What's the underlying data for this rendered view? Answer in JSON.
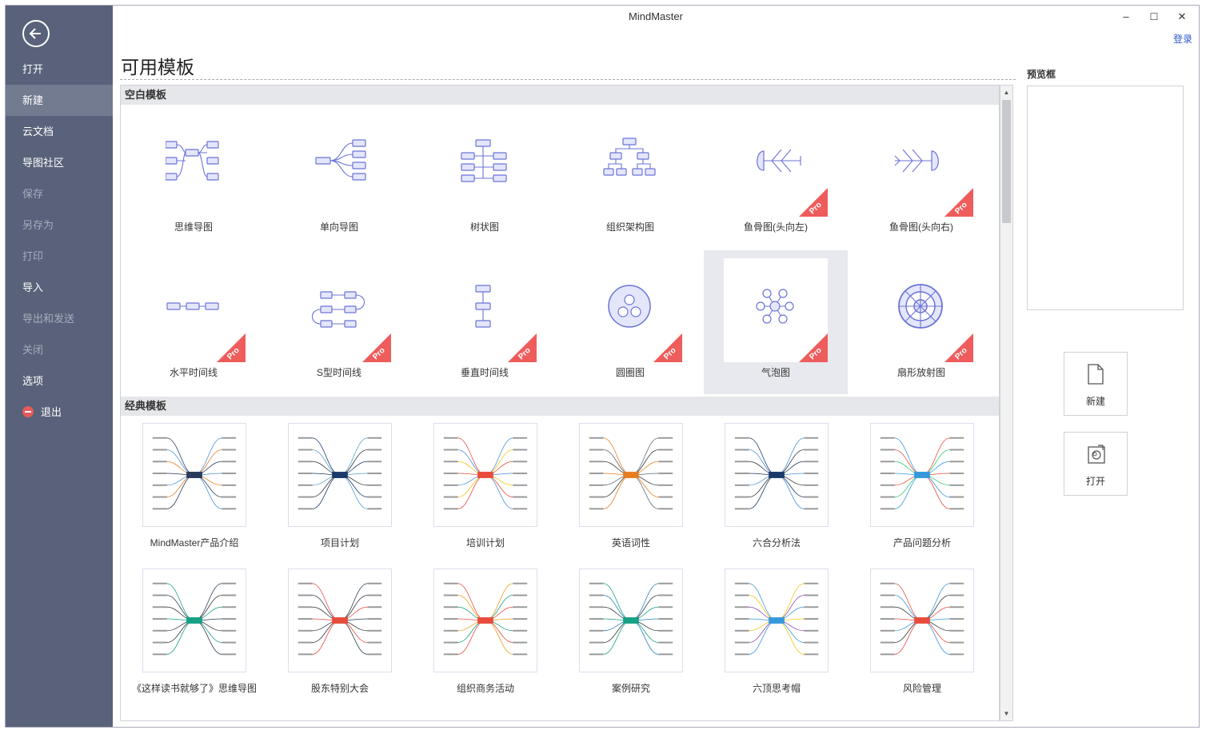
{
  "app": {
    "title": "MindMaster",
    "login": "登录",
    "page_title": "可用模板"
  },
  "sidebar": {
    "items": [
      {
        "label": "打开",
        "state": "normal"
      },
      {
        "label": "新建",
        "state": "active"
      },
      {
        "label": "云文档",
        "state": "normal"
      },
      {
        "label": "导图社区",
        "state": "normal"
      },
      {
        "label": "保存",
        "state": "disabled"
      },
      {
        "label": "另存为",
        "state": "disabled"
      },
      {
        "label": "打印",
        "state": "disabled"
      },
      {
        "label": "导入",
        "state": "normal"
      },
      {
        "label": "导出和发送",
        "state": "disabled"
      },
      {
        "label": "关闭",
        "state": "disabled"
      },
      {
        "label": "选项",
        "state": "normal"
      },
      {
        "label": "退出",
        "state": "normal"
      }
    ]
  },
  "window_controls": {
    "minimize": "–",
    "maximize": "☐",
    "close": "✕"
  },
  "blank_section": {
    "title": "空白模板",
    "templates": [
      {
        "label": "思维导图",
        "icon": "mindmap-icon",
        "pro": false,
        "pro_text": ""
      },
      {
        "label": "单向导图",
        "icon": "right-map-icon",
        "pro": false,
        "pro_text": ""
      },
      {
        "label": "树状图",
        "icon": "tree-icon",
        "pro": false,
        "pro_text": ""
      },
      {
        "label": "组织架构图",
        "icon": "org-chart-icon",
        "pro": false,
        "pro_text": ""
      },
      {
        "label": "鱼骨图(头向左)",
        "icon": "fishbone-left-icon",
        "pro": true,
        "pro_text": "Pro"
      },
      {
        "label": "鱼骨图(头向右)",
        "icon": "fishbone-right-icon",
        "pro": true,
        "pro_text": "Pro"
      },
      {
        "label": "水平时间线",
        "icon": "horizontal-timeline-icon",
        "pro": true,
        "pro_text": "Pro"
      },
      {
        "label": "S型时间线",
        "icon": "s-timeline-icon",
        "pro": true,
        "pro_text": "Pro"
      },
      {
        "label": "垂直时间线",
        "icon": "vertical-timeline-icon",
        "pro": true,
        "pro_text": "Pro"
      },
      {
        "label": "圆圈图",
        "icon": "circle-map-icon",
        "pro": true,
        "pro_text": "Pro"
      },
      {
        "label": "气泡图",
        "icon": "bubble-map-icon",
        "pro": true,
        "pro_text": "Pro"
      },
      {
        "label": "扇形放射图",
        "icon": "sector-radial-icon",
        "pro": true,
        "pro_text": "Pro"
      }
    ]
  },
  "classic_section": {
    "title": "经典模板",
    "templates": [
      {
        "label": "MindMaster产品介绍"
      },
      {
        "label": "项目计划"
      },
      {
        "label": "培训计划"
      },
      {
        "label": "英语词性"
      },
      {
        "label": "六合分析法"
      },
      {
        "label": "产品问题分析"
      },
      {
        "label": "《这样读书就够了》思维导图"
      },
      {
        "label": "股东特别大会"
      },
      {
        "label": "组织商务活动"
      },
      {
        "label": "案例研究"
      },
      {
        "label": "六顶思考帽"
      },
      {
        "label": "风险管理"
      }
    ]
  },
  "preview": {
    "label": "预览框"
  },
  "actions": {
    "new_label": "新建",
    "open_label": "打开"
  },
  "colors": {
    "sidebar": "#59627a",
    "accent": "#6b73d6",
    "pro": "#ef5c5c"
  }
}
